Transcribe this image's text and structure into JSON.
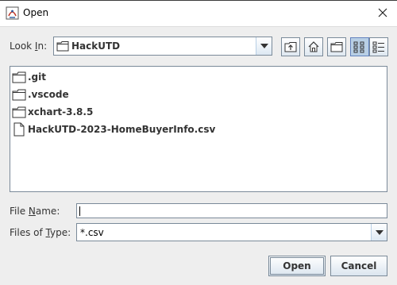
{
  "window": {
    "title": "Open"
  },
  "look_in": {
    "label_pre": "Look ",
    "label_mnemonic": "I",
    "label_post": "n:",
    "selected": "HackUTD"
  },
  "toolbar": {
    "buttons": [
      "up-one-level-icon",
      "home-icon",
      "new-folder-icon",
      "list-view-icon",
      "details-view-icon"
    ],
    "selected_view": "list-view-icon"
  },
  "files": [
    {
      "name": ".git",
      "type": "folder",
      "icon": "folder-icon"
    },
    {
      "name": ".vscode",
      "type": "folder",
      "icon": "folder-icon"
    },
    {
      "name": "xchart-3.8.5",
      "type": "folder",
      "icon": "folder-icon"
    },
    {
      "name": "HackUTD-2023-HomeBuyerInfo.csv",
      "type": "file",
      "icon": "file-icon"
    }
  ],
  "file_name": {
    "label_pre": "File ",
    "label_mnemonic": "N",
    "label_post": "ame:",
    "value": ""
  },
  "file_type": {
    "label_pre": "Files of ",
    "label_mnemonic": "T",
    "label_post": "ype:",
    "selected": "*.csv"
  },
  "actions": {
    "open_label": "Open",
    "cancel_label": "Cancel"
  },
  "colors": {
    "dialog_bg": "#eeeeee",
    "border": "#7a8a99",
    "selected_button": "#b8cfe5"
  }
}
